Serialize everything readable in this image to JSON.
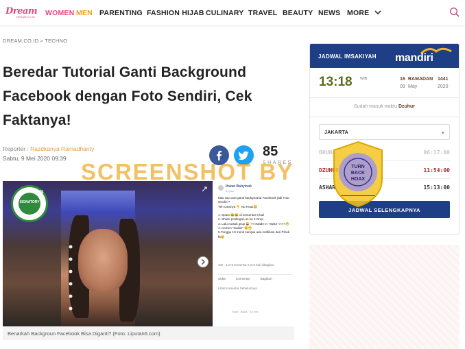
{
  "nav": {
    "logo": "Dream",
    "logo_sub": "DREAM.CO.ID",
    "items": [
      "WOMEN",
      "MEN",
      "PARENTING",
      "FASHION HIJAB",
      "CULINARY",
      "TRAVEL",
      "BEAUTY",
      "NEWS",
      "MORE"
    ]
  },
  "breadcrumb": {
    "site": "DREAM.CO.ID",
    "sep": ">",
    "section": "TECHNO"
  },
  "article": {
    "title": "Beredar Tutorial Ganti Background Facebook dengan Foto Sendiri, Cek Faktanya!",
    "reporter_label": "Reporter :",
    "reporter_name": "Razdkanya Ramadhanty",
    "date": "Sabtu, 9 Mei 2020 09:39",
    "share_count": "85",
    "share_label": "SHARES",
    "caption": "Benarkah Backgroun Facebook Bisa Diganti? (Foto: Liputan6.com)"
  },
  "hero_image": {
    "badge_top": "IFCN",
    "badge_text": "SIGNATORY",
    "post_name": "Ihwan Babylook",
    "post_time": "14 jam",
    "post_body": "Mau tau cara ganti background Facebook jadi Foto sendiri ?\nYeh caranya 👇 No Hoax😊\n\n1. Spam 😂😆 di komentar 5 kali\n2. Share postingan ini ke 3 Grup\n3. Lalu masuk grup 😜 <<<Made In +6262 <<<<😁\n4. Komen \"sudah\" 😊😁\n5.Tunggu 10 menit sampai ada notifikasi dari Pihak fb😊",
    "post_stats": "102 · 2,2 rb Komentar 2,3 rb Kali dibagikan",
    "action_like": "Suka",
    "action_comment": "Komentar",
    "action_share": "Bagikan",
    "comments_link": "Lihat Komentar Sebelumnya",
    "reply_meta": "Suka · Balas · 32 mnt"
  },
  "watermark": {
    "text": "SCREENSHOT BY",
    "seal_text": "TURN BACK HOAX"
  },
  "widget": {
    "header_title": "JADWAL IMSAKIYAH",
    "bank": "mandiri",
    "time": "13:18",
    "time_zone": "WIB",
    "hijri_day": "16",
    "hijri_month": "RAMADAN",
    "hijri_year": "1441",
    "greg_day": "09",
    "greg_month": "May",
    "greg_year": "2020",
    "status_prefix": "Sudah masuk waktu",
    "status_prayer": "Dzuhur",
    "city": "JAKARTA",
    "prayers": [
      {
        "name": "DHUHA",
        "time": "06:17:00"
      },
      {
        "name": "DZUHUR",
        "time": "11:54:00"
      },
      {
        "name": "ASHAR",
        "time": "15:13:00"
      }
    ],
    "button": "JADWAL SELENGKAPNYA"
  },
  "colors": {
    "brand_pink": "#e7487f",
    "brand_orange": "#f0a01e",
    "mandiri_blue": "#1e3e86",
    "active_prayer": "#b8242a"
  }
}
